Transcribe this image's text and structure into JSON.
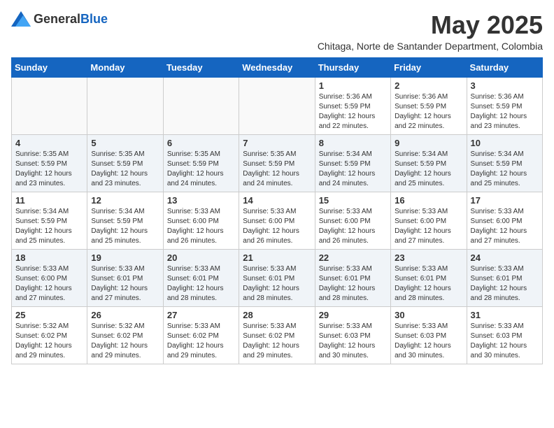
{
  "logo": {
    "general": "General",
    "blue": "Blue"
  },
  "title": "May 2025",
  "subtitle": "Chitaga, Norte de Santander Department, Colombia",
  "days_of_week": [
    "Sunday",
    "Monday",
    "Tuesday",
    "Wednesday",
    "Thursday",
    "Friday",
    "Saturday"
  ],
  "weeks": [
    [
      {
        "day": "",
        "info": ""
      },
      {
        "day": "",
        "info": ""
      },
      {
        "day": "",
        "info": ""
      },
      {
        "day": "",
        "info": ""
      },
      {
        "day": "1",
        "info": "Sunrise: 5:36 AM\nSunset: 5:59 PM\nDaylight: 12 hours\nand 22 minutes."
      },
      {
        "day": "2",
        "info": "Sunrise: 5:36 AM\nSunset: 5:59 PM\nDaylight: 12 hours\nand 22 minutes."
      },
      {
        "day": "3",
        "info": "Sunrise: 5:36 AM\nSunset: 5:59 PM\nDaylight: 12 hours\nand 23 minutes."
      }
    ],
    [
      {
        "day": "4",
        "info": "Sunrise: 5:35 AM\nSunset: 5:59 PM\nDaylight: 12 hours\nand 23 minutes."
      },
      {
        "day": "5",
        "info": "Sunrise: 5:35 AM\nSunset: 5:59 PM\nDaylight: 12 hours\nand 23 minutes."
      },
      {
        "day": "6",
        "info": "Sunrise: 5:35 AM\nSunset: 5:59 PM\nDaylight: 12 hours\nand 24 minutes."
      },
      {
        "day": "7",
        "info": "Sunrise: 5:35 AM\nSunset: 5:59 PM\nDaylight: 12 hours\nand 24 minutes."
      },
      {
        "day": "8",
        "info": "Sunrise: 5:34 AM\nSunset: 5:59 PM\nDaylight: 12 hours\nand 24 minutes."
      },
      {
        "day": "9",
        "info": "Sunrise: 5:34 AM\nSunset: 5:59 PM\nDaylight: 12 hours\nand 25 minutes."
      },
      {
        "day": "10",
        "info": "Sunrise: 5:34 AM\nSunset: 5:59 PM\nDaylight: 12 hours\nand 25 minutes."
      }
    ],
    [
      {
        "day": "11",
        "info": "Sunrise: 5:34 AM\nSunset: 5:59 PM\nDaylight: 12 hours\nand 25 minutes."
      },
      {
        "day": "12",
        "info": "Sunrise: 5:34 AM\nSunset: 5:59 PM\nDaylight: 12 hours\nand 25 minutes."
      },
      {
        "day": "13",
        "info": "Sunrise: 5:33 AM\nSunset: 6:00 PM\nDaylight: 12 hours\nand 26 minutes."
      },
      {
        "day": "14",
        "info": "Sunrise: 5:33 AM\nSunset: 6:00 PM\nDaylight: 12 hours\nand 26 minutes."
      },
      {
        "day": "15",
        "info": "Sunrise: 5:33 AM\nSunset: 6:00 PM\nDaylight: 12 hours\nand 26 minutes."
      },
      {
        "day": "16",
        "info": "Sunrise: 5:33 AM\nSunset: 6:00 PM\nDaylight: 12 hours\nand 27 minutes."
      },
      {
        "day": "17",
        "info": "Sunrise: 5:33 AM\nSunset: 6:00 PM\nDaylight: 12 hours\nand 27 minutes."
      }
    ],
    [
      {
        "day": "18",
        "info": "Sunrise: 5:33 AM\nSunset: 6:00 PM\nDaylight: 12 hours\nand 27 minutes."
      },
      {
        "day": "19",
        "info": "Sunrise: 5:33 AM\nSunset: 6:01 PM\nDaylight: 12 hours\nand 27 minutes."
      },
      {
        "day": "20",
        "info": "Sunrise: 5:33 AM\nSunset: 6:01 PM\nDaylight: 12 hours\nand 28 minutes."
      },
      {
        "day": "21",
        "info": "Sunrise: 5:33 AM\nSunset: 6:01 PM\nDaylight: 12 hours\nand 28 minutes."
      },
      {
        "day": "22",
        "info": "Sunrise: 5:33 AM\nSunset: 6:01 PM\nDaylight: 12 hours\nand 28 minutes."
      },
      {
        "day": "23",
        "info": "Sunrise: 5:33 AM\nSunset: 6:01 PM\nDaylight: 12 hours\nand 28 minutes."
      },
      {
        "day": "24",
        "info": "Sunrise: 5:33 AM\nSunset: 6:01 PM\nDaylight: 12 hours\nand 28 minutes."
      }
    ],
    [
      {
        "day": "25",
        "info": "Sunrise: 5:32 AM\nSunset: 6:02 PM\nDaylight: 12 hours\nand 29 minutes."
      },
      {
        "day": "26",
        "info": "Sunrise: 5:32 AM\nSunset: 6:02 PM\nDaylight: 12 hours\nand 29 minutes."
      },
      {
        "day": "27",
        "info": "Sunrise: 5:33 AM\nSunset: 6:02 PM\nDaylight: 12 hours\nand 29 minutes."
      },
      {
        "day": "28",
        "info": "Sunrise: 5:33 AM\nSunset: 6:02 PM\nDaylight: 12 hours\nand 29 minutes."
      },
      {
        "day": "29",
        "info": "Sunrise: 5:33 AM\nSunset: 6:03 PM\nDaylight: 12 hours\nand 30 minutes."
      },
      {
        "day": "30",
        "info": "Sunrise: 5:33 AM\nSunset: 6:03 PM\nDaylight: 12 hours\nand 30 minutes."
      },
      {
        "day": "31",
        "info": "Sunrise: 5:33 AM\nSunset: 6:03 PM\nDaylight: 12 hours\nand 30 minutes."
      }
    ]
  ]
}
